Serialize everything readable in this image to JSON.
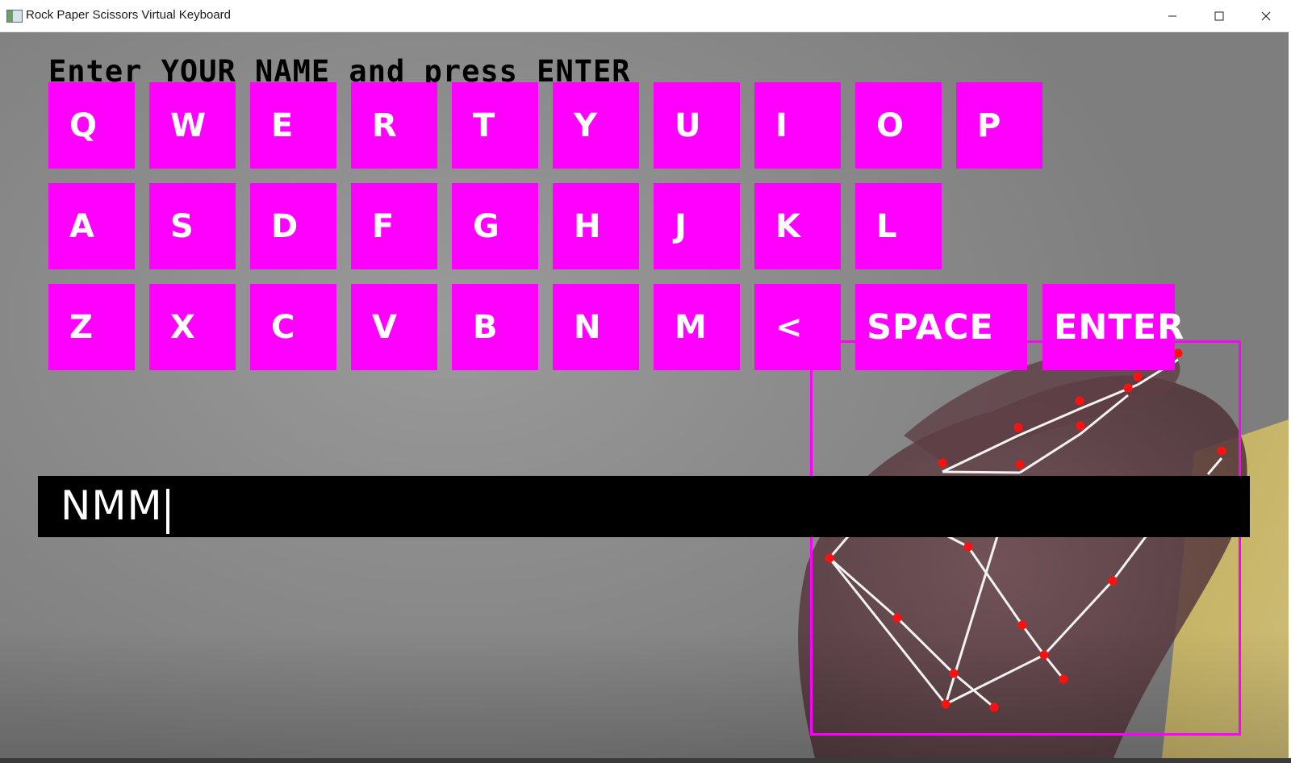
{
  "window": {
    "title": "Rock Paper Scissors Virtual Keyboard",
    "controls": [
      "minimize",
      "maximize",
      "close"
    ]
  },
  "prompt": "Enter YOUR NAME and press ENTER",
  "keyboard": {
    "row1": [
      "Q",
      "W",
      "E",
      "R",
      "T",
      "Y",
      "U",
      "I",
      "O",
      "P"
    ],
    "row2": [
      "A",
      "S",
      "D",
      "F",
      "G",
      "H",
      "J",
      "K",
      "L"
    ],
    "row3": [
      "Z",
      "X",
      "C",
      "V",
      "B",
      "N",
      "M",
      "<"
    ],
    "space_label": "SPACE",
    "enter_label": "ENTER"
  },
  "input": {
    "value": "NMM"
  },
  "colors": {
    "key": "#ff00ff",
    "key_text": "#ffffff",
    "bar": "#000000",
    "landmark": "#ff0000",
    "connection": "#ffffff"
  }
}
